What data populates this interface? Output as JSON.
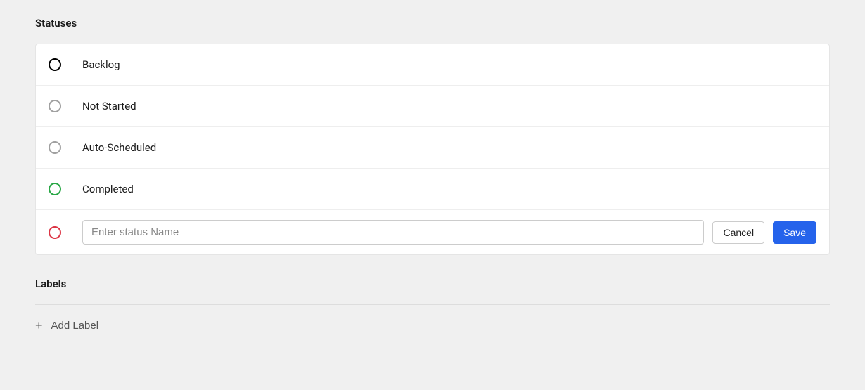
{
  "statuses": {
    "heading": "Statuses",
    "items": [
      {
        "label": "Backlog",
        "color": "black"
      },
      {
        "label": "Not Started",
        "color": "gray"
      },
      {
        "label": "Auto-Scheduled",
        "color": "gray"
      },
      {
        "label": "Completed",
        "color": "green"
      }
    ],
    "new": {
      "color": "red",
      "placeholder": "Enter status Name",
      "value": "",
      "cancel_label": "Cancel",
      "save_label": "Save"
    }
  },
  "labels": {
    "heading": "Labels",
    "add_button": "Add Label"
  }
}
